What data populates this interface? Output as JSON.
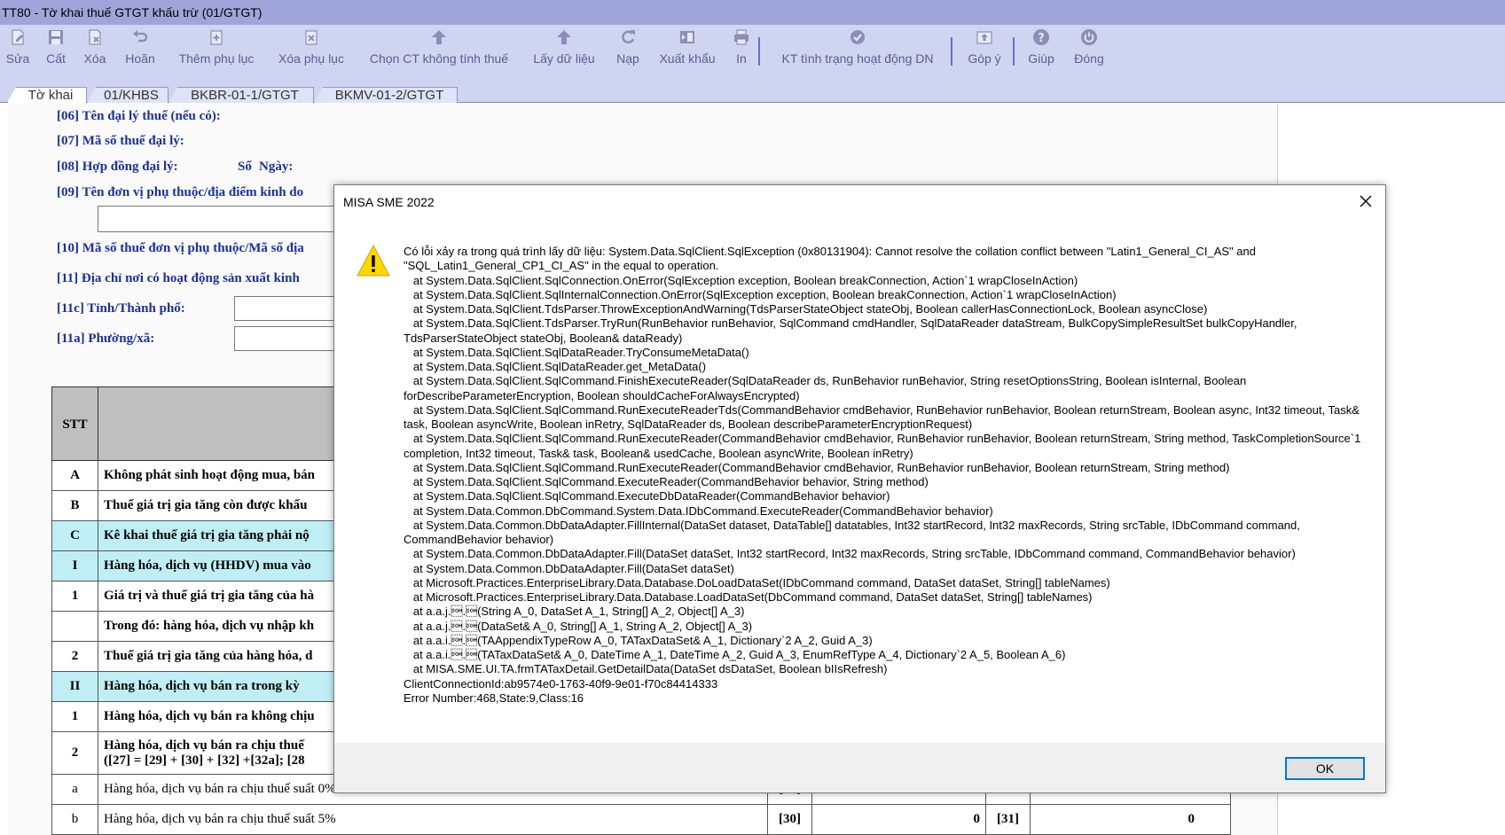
{
  "window": {
    "title": "TT80 - Tờ khai thuế GTGT khấu trừ (01/GTGT)"
  },
  "toolbar": {
    "buttons": [
      {
        "label": "Sửa",
        "icon": "edit-icon"
      },
      {
        "label": "Cất",
        "icon": "save-icon"
      },
      {
        "label": "Xóa",
        "icon": "delete-icon"
      },
      {
        "label": "Hoãn",
        "icon": "undo-icon"
      },
      {
        "label": "Thêm phụ lục",
        "icon": "add-appendix-icon"
      },
      {
        "label": "Xóa phụ lục",
        "icon": "delete-appendix-icon"
      },
      {
        "label": "Chọn CT không tính thuế",
        "icon": "arrow-up-icon"
      },
      {
        "label": "Lấy dữ liệu",
        "icon": "arrow-up-icon"
      },
      {
        "label": "Nạp",
        "icon": "refresh-icon"
      },
      {
        "label": "Xuất khẩu",
        "icon": "export-icon"
      },
      {
        "label": "In",
        "icon": "printer-icon"
      },
      {
        "label": "KT tình trạng hoạt động DN",
        "icon": "check-icon"
      },
      {
        "label": "Góp ý",
        "icon": "feedback-icon"
      },
      {
        "label": "Giúp",
        "icon": "help-icon"
      },
      {
        "label": "Đóng",
        "icon": "power-icon"
      }
    ]
  },
  "tabs": [
    {
      "label": "Tờ khai",
      "active": true
    },
    {
      "label": "01/KHBS",
      "active": false
    },
    {
      "label": "BKBR-01-1/GTGT",
      "active": false
    },
    {
      "label": "BKMV-01-2/GTGT",
      "active": false
    }
  ],
  "form": {
    "line06": "[06] Tên đại lý thuế (nếu có):",
    "line07": "[07] Mã số thuế đại lý:",
    "line08": "[08] Hợp đồng đại lý:",
    "line08_so": "Số",
    "line08_ngay": "Ngày:",
    "line09": "[09] Tên đơn vị phụ thuộc/địa điểm kinh do",
    "line10": "[10] Mã số thuế đơn vị phụ thuộc/Mã số địa",
    "line11": "[11] Địa chỉ nơi có hoạt động sản xuất kinh",
    "line11c": "[11c] Tỉnh/Thành phố:",
    "line11a": "[11a] Phường/xã:"
  },
  "table": {
    "header_stt": "STT",
    "rows": [
      {
        "stt": "A",
        "text": "Không phát sinh hoạt động mua, bán",
        "style": "white"
      },
      {
        "stt": "B",
        "text": "Thuế giá trị gia tăng còn được khấu",
        "style": "white"
      },
      {
        "stt": "C",
        "text": "Kê khai thuế giá trị gia tăng phải nộ",
        "style": "cyan"
      },
      {
        "stt": "I",
        "text": "Hàng hóa, dịch vụ (HHDV) mua vào",
        "style": "cyan"
      },
      {
        "stt": "1",
        "text": "Giá trị và thuế giá trị gia tăng của hà",
        "style": "white"
      },
      {
        "stt": "",
        "text": "Trong đó: hàng hóa, dịch vụ nhập kh",
        "style": "white"
      },
      {
        "stt": "2",
        "text": "Thuế giá trị gia tăng của hàng hóa, d",
        "style": "white"
      },
      {
        "stt": "II",
        "text": "Hàng hóa, dịch vụ bán ra trong kỳ",
        "style": "cyan"
      },
      {
        "stt": "1",
        "text": "Hàng hóa, dịch vụ bán ra không chịu",
        "style": "white"
      },
      {
        "stt": "2",
        "text": "Hàng hóa, dịch vụ bán ra chịu thuế",
        "text2": "([27] = [29] + [30] + [32] +[32a]; [28",
        "style": "white"
      },
      {
        "stt": "a",
        "text": "Hàng hóa, dịch vụ bán ra chịu thuế suất 0%",
        "style": "normal",
        "code1": "[29]",
        "val1": "",
        "code2": "",
        "val2": ""
      },
      {
        "stt": "b",
        "text": "Hàng hóa, dịch vụ bán ra chịu thuế suất 5%",
        "style": "normal",
        "code1": "[30]",
        "val1": "0",
        "code2": "[31]",
        "val2": "0"
      }
    ]
  },
  "dialog": {
    "title": "MISA SME 2022",
    "message": "Có lỗi xảy ra trong quá trình lấy dữ liệu: System.Data.SqlClient.SqlException (0x80131904): Cannot resolve the collation conflict between \"Latin1_General_CI_AS\" and \"SQL_Latin1_General_CP1_CI_AS\" in the equal to operation.\n   at System.Data.SqlClient.SqlConnection.OnError(SqlException exception, Boolean breakConnection, Action`1 wrapCloseInAction)\n   at System.Data.SqlClient.SqlInternalConnection.OnError(SqlException exception, Boolean breakConnection, Action`1 wrapCloseInAction)\n   at System.Data.SqlClient.TdsParser.ThrowExceptionAndWarning(TdsParserStateObject stateObj, Boolean callerHasConnectionLock, Boolean asyncClose)\n   at System.Data.SqlClient.TdsParser.TryRun(RunBehavior runBehavior, SqlCommand cmdHandler, SqlDataReader dataStream, BulkCopySimpleResultSet bulkCopyHandler, TdsParserStateObject stateObj, Boolean& dataReady)\n   at System.Data.SqlClient.SqlDataReader.TryConsumeMetaData()\n   at System.Data.SqlClient.SqlDataReader.get_MetaData()\n   at System.Data.SqlClient.SqlCommand.FinishExecuteReader(SqlDataReader ds, RunBehavior runBehavior, String resetOptionsString, Boolean isInternal, Boolean forDescribeParameterEncryption, Boolean shouldCacheForAlwaysEncrypted)\n   at System.Data.SqlClient.SqlCommand.RunExecuteReaderTds(CommandBehavior cmdBehavior, RunBehavior runBehavior, Boolean returnStream, Boolean async, Int32 timeout, Task& task, Boolean asyncWrite, Boolean inRetry, SqlDataReader ds, Boolean describeParameterEncryptionRequest)\n   at System.Data.SqlClient.SqlCommand.RunExecuteReader(CommandBehavior cmdBehavior, RunBehavior runBehavior, Boolean returnStream, String method, TaskCompletionSource`1 completion, Int32 timeout, Task& task, Boolean& usedCache, Boolean asyncWrite, Boolean inRetry)\n   at System.Data.SqlClient.SqlCommand.RunExecuteReader(CommandBehavior cmdBehavior, RunBehavior runBehavior, Boolean returnStream, String method)\n   at System.Data.SqlClient.SqlCommand.ExecuteReader(CommandBehavior behavior, String method)\n   at System.Data.SqlClient.SqlCommand.ExecuteDbDataReader(CommandBehavior behavior)\n   at System.Data.Common.DbCommand.System.Data.IDbCommand.ExecuteReader(CommandBehavior behavior)\n   at System.Data.Common.DbDataAdapter.FillInternal(DataSet dataset, DataTable[] datatables, Int32 startRecord, Int32 maxRecords, String srcTable, IDbCommand command, CommandBehavior behavior)\n   at System.Data.Common.DbDataAdapter.Fill(DataSet dataSet, Int32 startRecord, Int32 maxRecords, String srcTable, IDbCommand command, CommandBehavior behavior)\n   at System.Data.Common.DbDataAdapter.Fill(DataSet dataSet)\n   at Microsoft.Practices.EnterpriseLibrary.Data.Database.DoLoadDataSet(IDbCommand command, DataSet dataSet, String[] tableNames)\n   at Microsoft.Practices.EnterpriseLibrary.Data.Database.LoadDataSet(DbCommand command, DataSet dataSet, String[] tableNames)\n   at a.a.j.\u0001.\u0001(String A_0, DataSet A_1, String[] A_2, Object[] A_3)\n   at a.a.j.\u0001.\u0001(DataSet& A_0, String[] A_1, String A_2, Object[] A_3)\n   at a.a.i.\u0001.\u0001(TAAppendixTypeRow A_0, TATaxDataSet& A_1, Dictionary`2 A_2, Guid A_3)\n   at a.a.i.\u0001.\u0001(TATaxDataSet& A_0, DateTime A_1, DateTime A_2, Guid A_3, EnumRefType A_4, Dictionary`2 A_5, Boolean A_6)\n   at MISA.SME.UI.TA.frmTATaxDetail.GetDetailData(DataSet dsDataSet, Boolean bIIsRefresh)\nClientConnectionId:ab9574e0-1763-40f9-9e01-f70c84414333\nError Number:468,State:9,Class:16",
    "ok_label": "OK"
  },
  "colors": {
    "title_bar": "#9fa5d8",
    "toolbar_bg": "#cfd4f1",
    "toolbar_text": "#5b5e8f",
    "form_label": "#1a2fa0",
    "row_highlight": "#bfeff5",
    "ok_border": "#0078d7"
  }
}
